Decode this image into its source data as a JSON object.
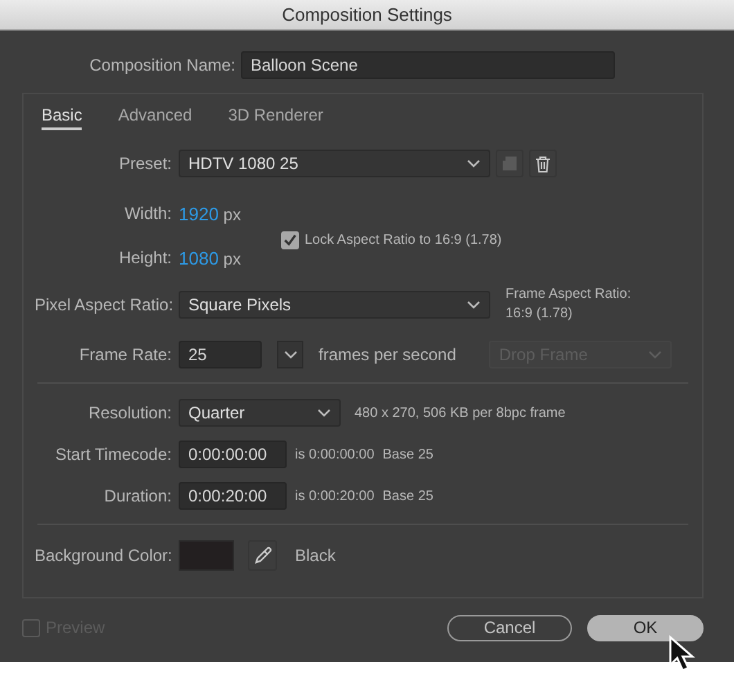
{
  "window": {
    "title": "Composition Settings"
  },
  "composition_name": {
    "label": "Composition Name:",
    "value": "Balloon Scene"
  },
  "tabs": [
    {
      "label": "Basic",
      "selected": true
    },
    {
      "label": "Advanced",
      "selected": false
    },
    {
      "label": "3D Renderer",
      "selected": false
    }
  ],
  "preset": {
    "label": "Preset:",
    "value": "HDTV 1080 25"
  },
  "width": {
    "label": "Width:",
    "value": "1920",
    "unit": "px"
  },
  "height": {
    "label": "Height:",
    "value": "1080",
    "unit": "px"
  },
  "lock_aspect": {
    "label": "Lock Aspect Ratio to 16:9 (1.78)",
    "checked": true
  },
  "pixel_aspect": {
    "label": "Pixel Aspect Ratio:",
    "value": "Square Pixels",
    "note_lines": [
      "Frame Aspect Ratio:",
      "16:9 (1.78)"
    ]
  },
  "frame_rate": {
    "label": "Frame Rate:",
    "value": "25",
    "unit": "frames per second",
    "drop_frame": {
      "value": "Drop Frame",
      "disabled": true
    }
  },
  "resolution": {
    "label": "Resolution:",
    "value": "Quarter",
    "info": "480 x 270, 506 KB per 8bpc frame"
  },
  "start_timecode": {
    "label": "Start Timecode:",
    "value": "0:00:00:00",
    "info": "is 0:00:00:00",
    "base": "Base 25"
  },
  "duration": {
    "label": "Duration:",
    "value": "0:00:20:00",
    "info": "is 0:00:20:00",
    "base": "Base 25"
  },
  "background_color": {
    "label": "Background Color:",
    "color": "#231f20",
    "name": "Black"
  },
  "preview": {
    "label": "Preview",
    "checked": false,
    "disabled": true
  },
  "buttons": [
    {
      "label": "Cancel",
      "kind": "secondary"
    },
    {
      "label": "OK",
      "kind": "primary"
    }
  ]
}
